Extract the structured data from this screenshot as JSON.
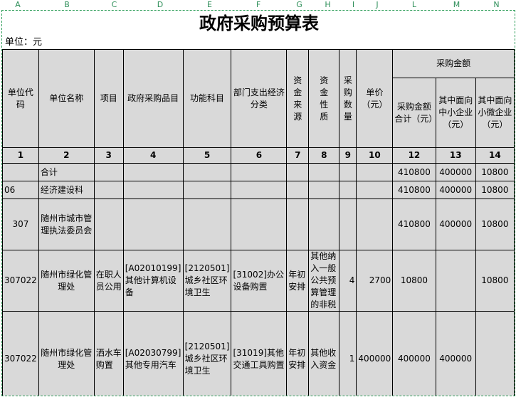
{
  "col_letters": [
    "A",
    "B",
    "C",
    "D",
    "E",
    "F",
    "G",
    "H",
    "I",
    "J",
    "L",
    "M",
    "N"
  ],
  "title": "政府采购预算表",
  "unit": "单位：元",
  "headers": {
    "unit_code": "单位代码",
    "unit_name": "单位名称",
    "item": "项目",
    "catalog": "政府采购品目",
    "func": "功能科目",
    "econ": "部门支出经济分类",
    "fund_src": "资金来源",
    "fund_nat": "资金性质",
    "qty": "采购数量",
    "price": "单价（元）",
    "amount_group": "采购金额",
    "amount_total": "采购金额合计（元）",
    "sme": "其中面向中小企业（元）",
    "micro": "其中面向小微企业（元）"
  },
  "col_numbers": [
    "1",
    "2",
    "3",
    "4",
    "5",
    "6",
    "7",
    "8",
    "9",
    "10",
    "12",
    "13",
    "14"
  ],
  "rows": [
    {
      "code": "",
      "name": "合计",
      "item": "",
      "catalog": "",
      "func": "",
      "econ": "",
      "fund_src": "",
      "fund_nat": "",
      "qty": "",
      "price": "",
      "total": "410800",
      "sme": "400000",
      "micro": "10800"
    },
    {
      "code": "06",
      "name": "经济建设科",
      "item": "",
      "catalog": "",
      "func": "",
      "econ": "",
      "fund_src": "",
      "fund_nat": "",
      "qty": "",
      "price": "",
      "total": "410800",
      "sme": "400000",
      "micro": "10800"
    },
    {
      "code": "307",
      "name": "随州市城市管理执法委员会",
      "item": "",
      "catalog": "",
      "func": "",
      "econ": "",
      "fund_src": "",
      "fund_nat": "",
      "qty": "",
      "price": "",
      "total": "410800",
      "sme": "400000",
      "micro": "10800"
    },
    {
      "code": "307022",
      "name": "随州市绿化管理处",
      "item": "在职人员公用",
      "catalog": "[A02010199]其他计算机设备",
      "func": "[2120501]城乡社区环境卫生",
      "econ": "[31002]办公设备购置",
      "fund_src": "年初安排",
      "fund_nat": "其他纳入一般公共预算管理的非税",
      "qty": "4",
      "price": "2700",
      "total": "10800",
      "sme": "",
      "micro": "10800"
    },
    {
      "code": "307022",
      "name": "随州市绿化管理处",
      "item": "洒水车购置",
      "catalog": "[A02030799]其他专用汽车",
      "func": "[2120501]城乡社区环境卫生",
      "econ": "[31019]其他交通工具购置",
      "fund_src": "年初安排",
      "fund_nat": "其他收入资金",
      "qty": "1",
      "price": "400000",
      "total": "400000",
      "sme": "400000",
      "micro": ""
    }
  ]
}
